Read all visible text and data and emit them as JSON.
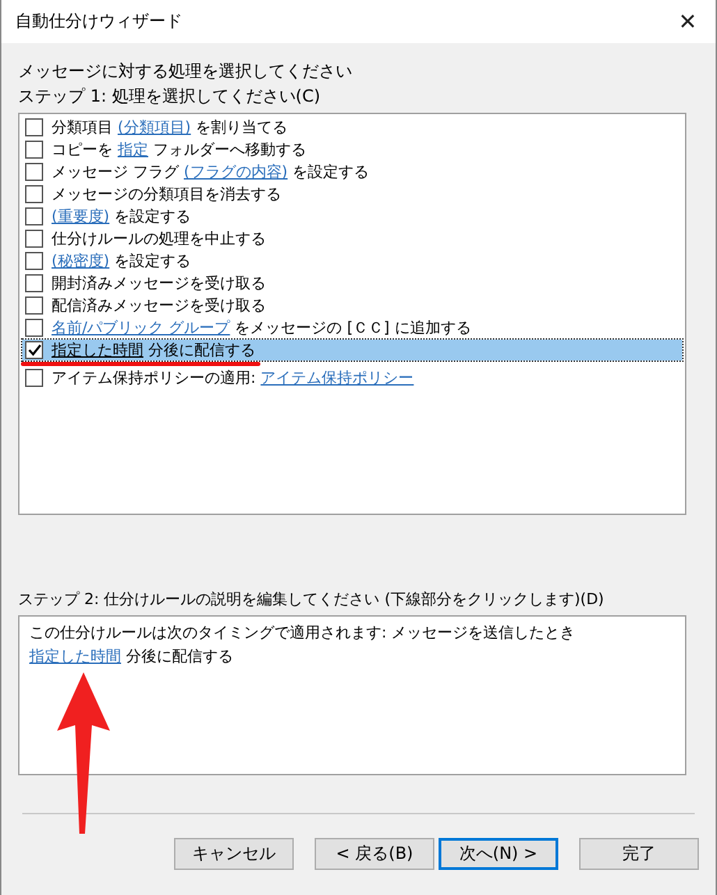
{
  "window": {
    "title": "自動仕分けウィザード",
    "close": "✕"
  },
  "heading": "メッセージに対する処理を選択してください",
  "step1_label": "ステップ 1: 処理を選択してください(C)",
  "actions": [
    {
      "checked": false,
      "selected": false,
      "segments": [
        {
          "text": "分類項目 ",
          "link": false
        },
        {
          "text": "(分類項目)",
          "link": true
        },
        {
          "text": " を割り当てる",
          "link": false
        }
      ]
    },
    {
      "checked": false,
      "selected": false,
      "segments": [
        {
          "text": "コピーを ",
          "link": false
        },
        {
          "text": "指定",
          "link": true
        },
        {
          "text": " フォルダーへ移動する",
          "link": false
        }
      ]
    },
    {
      "checked": false,
      "selected": false,
      "segments": [
        {
          "text": "メッセージ フラグ ",
          "link": false
        },
        {
          "text": "(フラグの内容)",
          "link": true
        },
        {
          "text": " を設定する",
          "link": false
        }
      ]
    },
    {
      "checked": false,
      "selected": false,
      "segments": [
        {
          "text": "メッセージの分類項目を消去する",
          "link": false
        }
      ]
    },
    {
      "checked": false,
      "selected": false,
      "segments": [
        {
          "text": "(重要度)",
          "link": true
        },
        {
          "text": " を設定する",
          "link": false
        }
      ]
    },
    {
      "checked": false,
      "selected": false,
      "segments": [
        {
          "text": "仕分けルールの処理を中止する",
          "link": false
        }
      ]
    },
    {
      "checked": false,
      "selected": false,
      "segments": [
        {
          "text": "(秘密度)",
          "link": true
        },
        {
          "text": " を設定する",
          "link": false
        }
      ]
    },
    {
      "checked": false,
      "selected": false,
      "segments": [
        {
          "text": "開封済みメッセージを受け取る",
          "link": false
        }
      ]
    },
    {
      "checked": false,
      "selected": false,
      "segments": [
        {
          "text": "配信済みメッセージを受け取る",
          "link": false
        }
      ]
    },
    {
      "checked": false,
      "selected": false,
      "segments": [
        {
          "text": "名前/パブリック グループ",
          "link": true
        },
        {
          "text": " をメッセージの [ＣＣ] に追加する",
          "link": false
        }
      ]
    },
    {
      "checked": true,
      "selected": true,
      "segments": [
        {
          "text": "指定した時間",
          "link": true
        },
        {
          "text": " 分後に配信する",
          "link": false
        }
      ]
    },
    {
      "checked": false,
      "selected": false,
      "segments": [
        {
          "text": "アイテム保持ポリシーの適用: ",
          "link": false
        },
        {
          "text": "アイテム保持ポリシー",
          "link": true
        }
      ]
    }
  ],
  "step2_label": "ステップ 2: 仕分けルールの説明を編集してください (下線部分をクリックします)(D)",
  "description": [
    [
      {
        "text": "この仕分けルールは次のタイミングで適用されます: メッセージを送信したとき",
        "link": false
      }
    ],
    [
      {
        "text": "指定した時間",
        "link": true
      },
      {
        "text": " 分後に配信する",
        "link": false
      }
    ]
  ],
  "buttons": [
    {
      "label": "キャンセル",
      "focused": false
    },
    {
      "label": "< 戻る(B)",
      "focused": false
    },
    {
      "label": "次へ(N) >",
      "focused": true
    },
    {
      "label": "完了",
      "focused": false
    }
  ]
}
